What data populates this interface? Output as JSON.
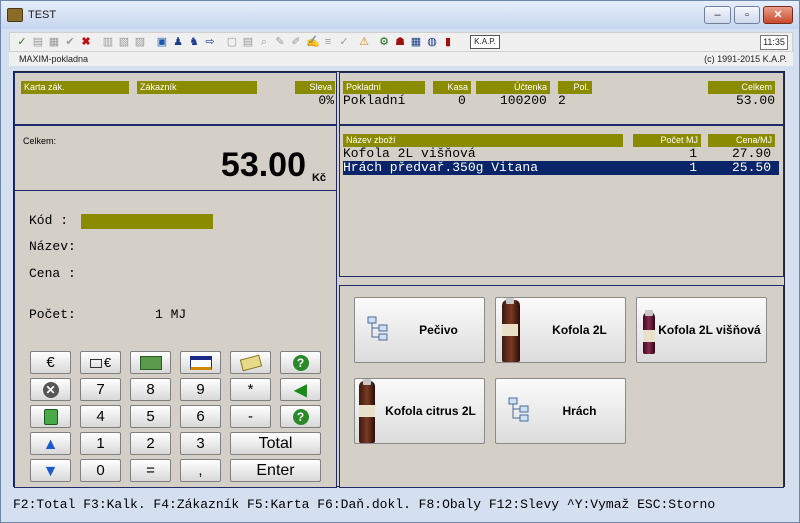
{
  "window": {
    "title": "TEST",
    "min_glyph": "‒",
    "max_glyph": "▫",
    "close_glyph": "✕"
  },
  "toolbar": {
    "kap_label": "K.A.P.",
    "clock": "11:35"
  },
  "subbar": {
    "app_name": "MAXIM-pokladna",
    "copyright": "(c) 1991-2015 K.A.P."
  },
  "customer": {
    "card_header": "Karta zák.",
    "customer_header": "Zákazník",
    "discount_header": "Sleva",
    "discount_value": "0%"
  },
  "receipt": {
    "cashier_header": "Pokladní",
    "till_header": "Kasa",
    "receipt_header": "Účtenka",
    "items_header": "Pol.",
    "total_header": "Celkem",
    "cashier_value": "Pokladní",
    "till_value": "0",
    "receipt_value": "100200",
    "items_value": "2",
    "total_value": "53.00"
  },
  "total": {
    "label": "Celkem:",
    "amount": "53.00",
    "currency": "Kč"
  },
  "entry": {
    "code_label": "Kód :",
    "name_label": "Název:",
    "price_label": "Cena :",
    "count_label": "Počet:",
    "count_value": "1 MJ"
  },
  "items": {
    "headers": {
      "name": "Název zboží",
      "count": "Počet MJ",
      "price": "Cena/MJ"
    },
    "rows": [
      {
        "name": "Kofola 2L višňová",
        "count": "1",
        "price": "27.90"
      },
      {
        "name": "Hrách předvař.350g Vitana",
        "count": "1",
        "price": "25.50"
      }
    ]
  },
  "keypad": {
    "euro": "€",
    "euro2": "€",
    "k7": "7",
    "k8": "8",
    "k9": "9",
    "star": "*",
    "k4": "4",
    "k5": "5",
    "k6": "6",
    "minus": "-",
    "k1": "1",
    "k2": "2",
    "k3": "3",
    "total": "Total",
    "k0": "0",
    "equals": "=",
    "comma": ",",
    "enter": "Enter"
  },
  "products": [
    {
      "label": "Pečivo"
    },
    {
      "label": "Kofola 2L"
    },
    {
      "label": "Kofola 2L višňová"
    },
    {
      "label": "Kofola citrus 2L"
    },
    {
      "label": "Hrách"
    }
  ],
  "statusbar": {
    "text": "F2:Total F3:Kalk. F4:Zákazník F5:Karta F6:Daň.dokl. F8:Obaly F12:Slevy ^Y:Vymaž ESC:Storno"
  }
}
